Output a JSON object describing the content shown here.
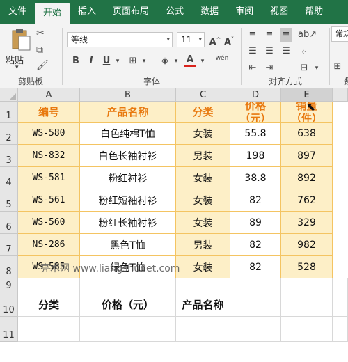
{
  "ribbon": {
    "tabs": [
      "文件",
      "开始",
      "插入",
      "页面布局",
      "公式",
      "数据",
      "审阅",
      "视图",
      "帮助"
    ],
    "active_tab_index": 1,
    "clipboard": {
      "paste_label": "粘贴",
      "group_label": "剪贴板"
    },
    "font": {
      "name": "等线",
      "size": "11",
      "group_label": "字体",
      "bold": "B",
      "italic": "I",
      "underline": "U",
      "font_color_letter": "A",
      "wen_glyph": "wén",
      "font_color_accent": "#d9231c"
    },
    "alignment": {
      "group_label": "对齐方式"
    },
    "number": {
      "format_partial": "常规",
      "group_label_partial": "数"
    }
  },
  "columns": [
    "A",
    "B",
    "C",
    "D",
    "E"
  ],
  "rows": [
    "1",
    "2",
    "3",
    "4",
    "5",
    "6",
    "7",
    "8",
    "9",
    "10",
    "11"
  ],
  "table": {
    "headers": [
      "编号",
      "产品名称",
      "分类",
      "价格（元）",
      "销量（件）"
    ],
    "headers_lines": [
      [
        "编号"
      ],
      [
        "产品名称"
      ],
      [
        "分类"
      ],
      [
        "价格",
        "（元）"
      ],
      [
        "销量",
        "（件）"
      ]
    ],
    "data": [
      [
        "WS-580",
        "白色纯棉T恤",
        "女装",
        "55.8",
        "638"
      ],
      [
        "NS-832",
        "白色长袖衬衫",
        "男装",
        "198",
        "897"
      ],
      [
        "WS-581",
        "粉红衬衫",
        "女装",
        "38.8",
        "892"
      ],
      [
        "WS-561",
        "粉红短袖衬衫",
        "女装",
        "82",
        "762"
      ],
      [
        "WS-560",
        "粉红长袖衬衫",
        "女装",
        "89",
        "329"
      ],
      [
        "NS-286",
        "黑色T恤",
        "男装",
        "82",
        "982"
      ],
      [
        "WS-585",
        "绿色T恤",
        "女装",
        "82",
        "528"
      ]
    ]
  },
  "criteria_row": [
    "分类",
    "价格（元）",
    "产品名称"
  ],
  "watermark": "亮术网 www.liangshunet.com",
  "colors": {
    "excel_green": "#217346",
    "band_fill": "#fdefc7",
    "band_border": "#f4c462",
    "header_text": "#e8790f"
  }
}
